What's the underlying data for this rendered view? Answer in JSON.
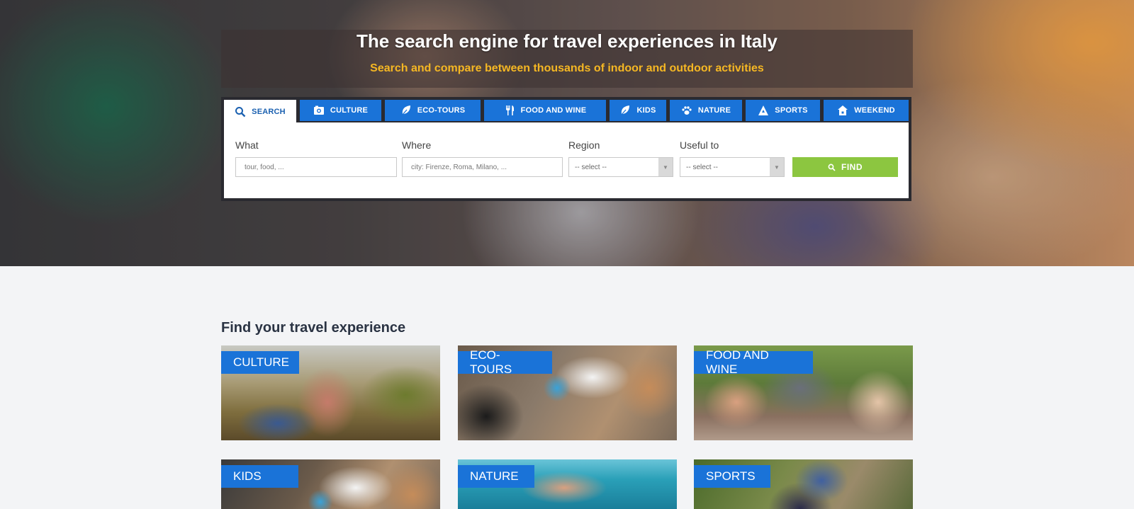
{
  "hero": {
    "title": "The search engine for travel experiences in Italy",
    "subtitle": "Search and compare between thousands of indoor and outdoor activities"
  },
  "tabs": [
    {
      "label": "SEARCH",
      "icon": "search-icon"
    },
    {
      "label": "CULTURE",
      "icon": "camera-icon"
    },
    {
      "label": "ECO-TOURS",
      "icon": "leaf-icon"
    },
    {
      "label": "FOOD AND WINE",
      "icon": "fork-knife-icon"
    },
    {
      "label": "KIDS",
      "icon": "leaf-icon"
    },
    {
      "label": "NATURE",
      "icon": "paw-icon"
    },
    {
      "label": "SPORTS",
      "icon": "mountain-icon"
    },
    {
      "label": "WEEKEND",
      "icon": "house-icon"
    }
  ],
  "search_form": {
    "what": {
      "label": "What",
      "placeholder": "tour, food, ..."
    },
    "where": {
      "label": "Where",
      "placeholder": "city: Firenze, Roma, Milano, ..."
    },
    "region": {
      "label": "Region",
      "value": "-- select --"
    },
    "useful_to": {
      "label": "Useful to",
      "value": "-- select --"
    },
    "find_label": "FIND"
  },
  "section": {
    "title": "Find your travel experience",
    "cards": [
      {
        "label": "CULTURE"
      },
      {
        "label": "ECO-TOURS"
      },
      {
        "label": "FOOD AND WINE"
      },
      {
        "label": "KIDS"
      },
      {
        "label": "NATURE"
      },
      {
        "label": "SPORTS"
      }
    ]
  },
  "colors": {
    "tab_blue": "#1a73d8",
    "find_green": "#8cc640",
    "subtitle_orange": "#f5b723"
  }
}
